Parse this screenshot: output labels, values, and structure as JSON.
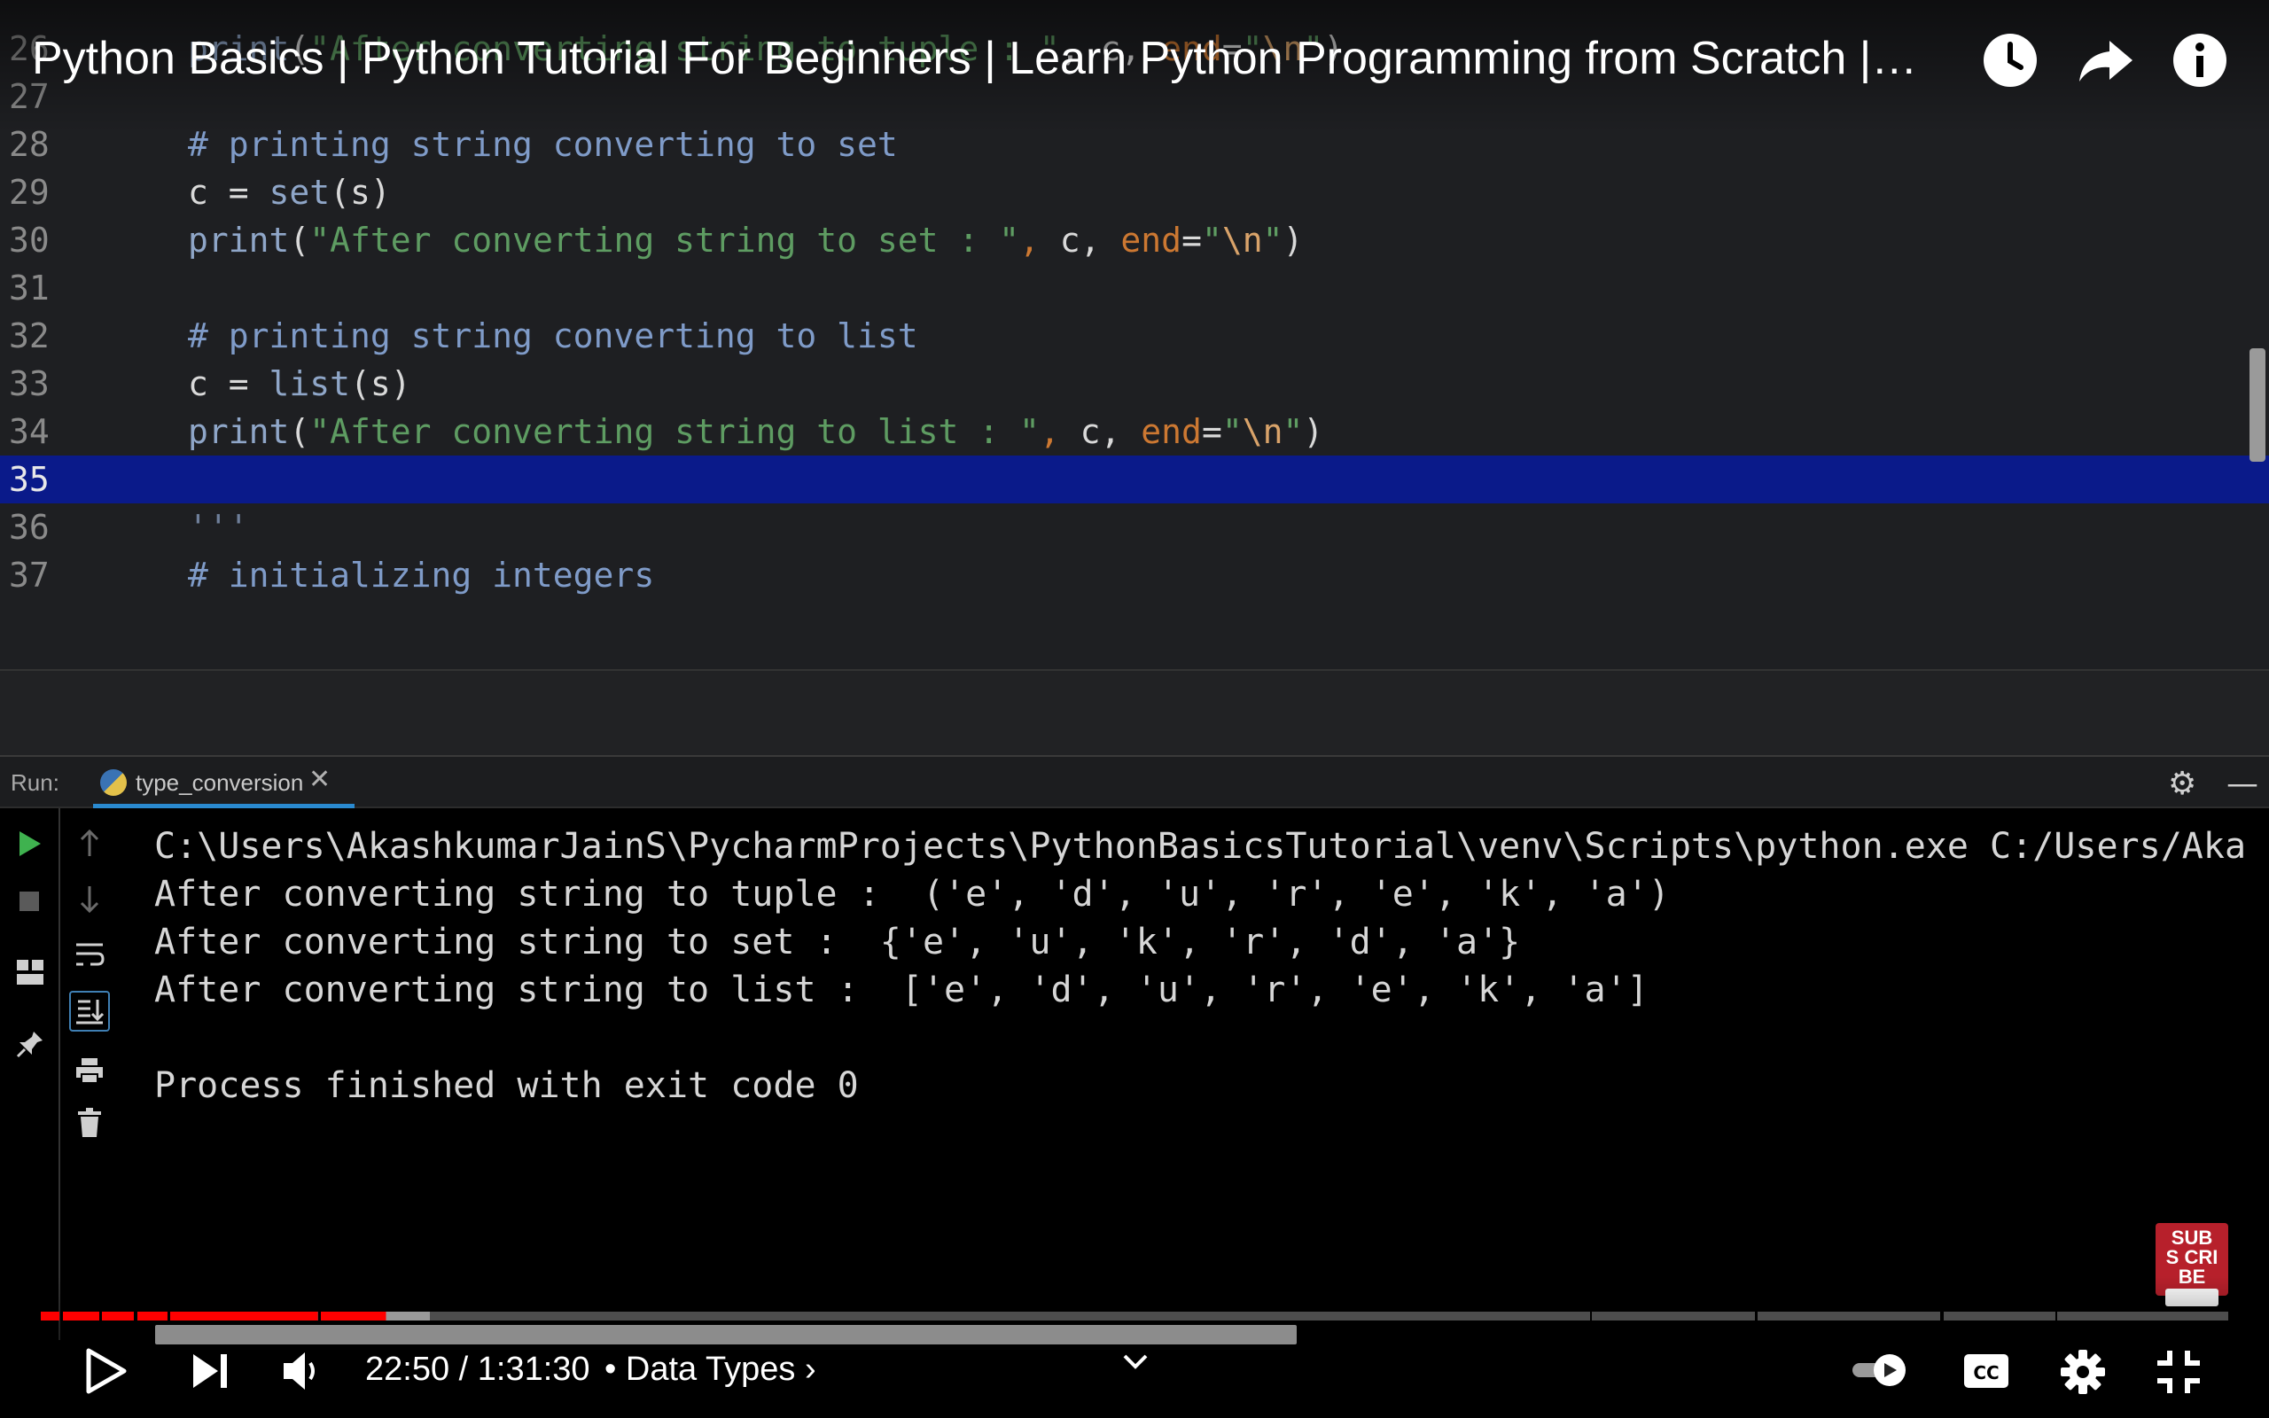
{
  "video": {
    "title": "Python Basics | Python Tutorial For Beginners | Learn Python Programming from Scratch |…",
    "time": "22:50 / 1:31:30",
    "chapter_separator": "•",
    "chapter": "Data Types",
    "chapter_arrow": "›",
    "progress_played": 0.158,
    "progress_buffered": 0.178,
    "subscribe_label": "SUBS CRIBE",
    "accent_color": "#ff0000"
  },
  "editor": {
    "lines": [
      {
        "n": "26",
        "tokens": [
          [
            "kw",
            "print"
          ],
          [
            "op",
            "("
          ],
          [
            "str",
            "\"After converting string to tuple : \""
          ],
          [
            "op",
            ", c, "
          ],
          [
            "org",
            "end"
          ],
          [
            "op",
            "="
          ],
          [
            "str",
            "\""
          ],
          [
            "esc",
            "\\n"
          ],
          [
            "str",
            "\""
          ],
          [
            "op",
            ")"
          ]
        ]
      },
      {
        "n": "27",
        "tokens": []
      },
      {
        "n": "28",
        "tokens": [
          [
            "cm",
            "# printing string converting to set"
          ]
        ]
      },
      {
        "n": "29",
        "tokens": [
          [
            "op",
            "c = "
          ],
          [
            "kw",
            "set"
          ],
          [
            "op",
            "(s)"
          ]
        ]
      },
      {
        "n": "30",
        "tokens": [
          [
            "kw",
            "print"
          ],
          [
            "op",
            "("
          ],
          [
            "str",
            "\"After converting string to set : \""
          ],
          [
            "org",
            ","
          ],
          [
            "op",
            " c, "
          ],
          [
            "org",
            "end"
          ],
          [
            "op",
            "="
          ],
          [
            "str",
            "\""
          ],
          [
            "esc",
            "\\n"
          ],
          [
            "str",
            "\""
          ],
          [
            "op",
            ")"
          ]
        ]
      },
      {
        "n": "31",
        "tokens": []
      },
      {
        "n": "32",
        "tokens": [
          [
            "cm",
            "# printing string converting to list"
          ]
        ]
      },
      {
        "n": "33",
        "tokens": [
          [
            "op",
            "c = "
          ],
          [
            "kw",
            "list"
          ],
          [
            "op",
            "(s)"
          ]
        ]
      },
      {
        "n": "34",
        "tokens": [
          [
            "kw",
            "print"
          ],
          [
            "op",
            "("
          ],
          [
            "str",
            "\"After converting string to list : \""
          ],
          [
            "org",
            ","
          ],
          [
            "op",
            " c, "
          ],
          [
            "org",
            "end"
          ],
          [
            "op",
            "="
          ],
          [
            "str",
            "\""
          ],
          [
            "esc",
            "\\n"
          ],
          [
            "str",
            "\""
          ],
          [
            "op",
            ")"
          ]
        ]
      },
      {
        "n": "35",
        "tokens": [],
        "current": true
      },
      {
        "n": "36",
        "tokens": [
          [
            "dim",
            "'''"
          ]
        ]
      },
      {
        "n": "37",
        "tokens": [
          [
            "cm",
            "# initializing integers"
          ]
        ]
      }
    ]
  },
  "run": {
    "label": "Run:",
    "tab_label": "type_conversion",
    "tab_close": "✕",
    "output": [
      "C:\\Users\\AkashkumarJainS\\PycharmProjects\\PythonBasicsTutorial\\venv\\Scripts\\python.exe C:/Users/Aka",
      "After converting string to tuple :  ('e', 'd', 'u', 'r', 'e', 'k', 'a')",
      "After converting string to set :  {'e', 'u', 'k', 'r', 'd', 'a'}",
      "After converting string to list :  ['e', 'd', 'u', 'r', 'e', 'k', 'a']",
      "",
      "Process finished with exit code 0"
    ]
  }
}
